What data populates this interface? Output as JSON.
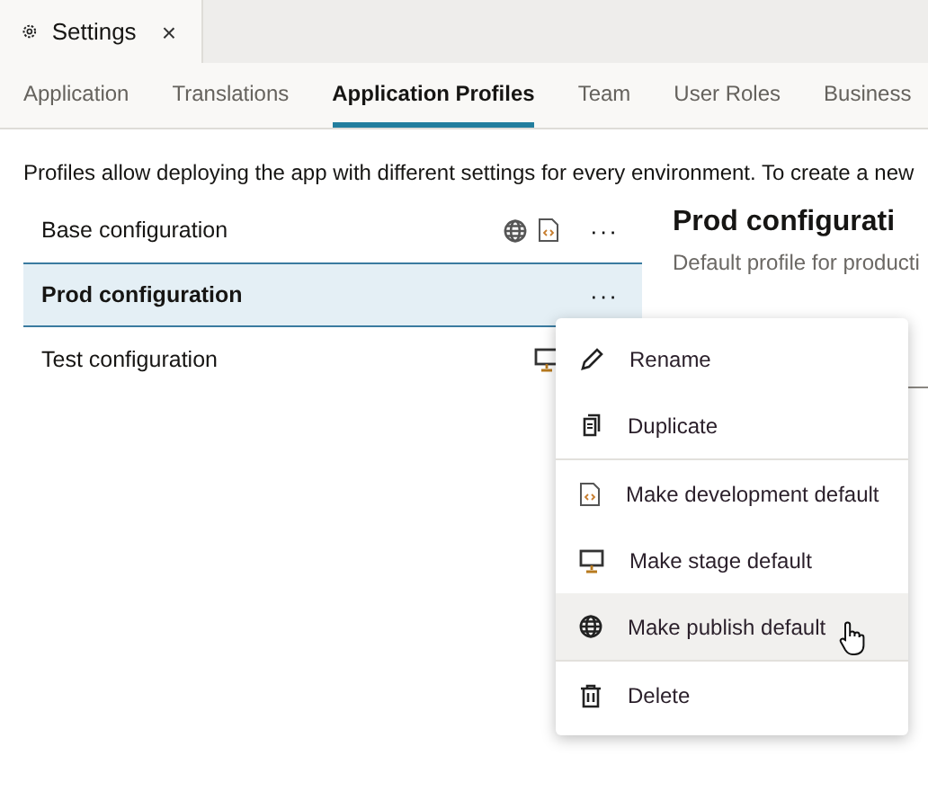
{
  "window_tab": {
    "title": "Settings",
    "close": "×"
  },
  "tabs": [
    {
      "label": "Application",
      "selected": false
    },
    {
      "label": "Translations",
      "selected": false
    },
    {
      "label": "Application Profiles",
      "selected": true
    },
    {
      "label": "Team",
      "selected": false
    },
    {
      "label": "User Roles",
      "selected": false
    },
    {
      "label": "Business",
      "selected": false
    }
  ],
  "description": "Profiles allow deploying the app with different settings for every environment. To create a new",
  "profiles": [
    {
      "name": "Base configuration",
      "selected": false,
      "badges": [
        {
          "kind": "publish"
        },
        {
          "kind": "development"
        }
      ],
      "more": "···"
    },
    {
      "name": "Prod configuration",
      "selected": true,
      "more": "···"
    },
    {
      "name": "Test configuration",
      "selected": false,
      "badges": [
        {
          "kind": "stage"
        }
      ]
    }
  ],
  "detail": {
    "title": "Prod configurati",
    "subtitle": "Default profile for producti"
  },
  "menu": {
    "groups": [
      [
        {
          "label": "Rename",
          "kind": "rename",
          "hovered": false
        },
        {
          "label": "Duplicate",
          "kind": "duplicate",
          "hovered": false
        }
      ],
      [
        {
          "label": "Make development default",
          "kind": "development",
          "hovered": false
        },
        {
          "label": "Make stage default",
          "kind": "stage",
          "hovered": false
        },
        {
          "label": "Make publish default",
          "kind": "publish",
          "hovered": true
        }
      ],
      [
        {
          "label": "Delete",
          "kind": "delete",
          "hovered": false
        }
      ]
    ]
  }
}
